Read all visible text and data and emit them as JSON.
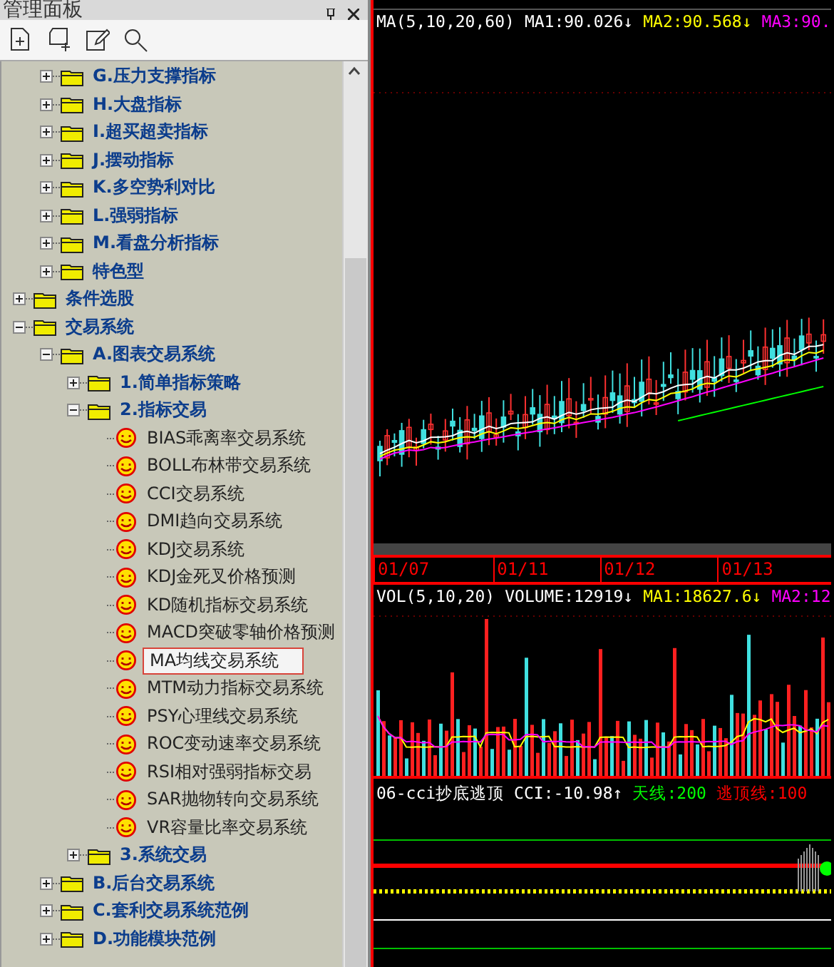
{
  "panel": {
    "title": "管理面板",
    "toolbar": [
      {
        "kind": "new-file"
      },
      {
        "kind": "new-folder"
      },
      {
        "kind": "edit"
      },
      {
        "kind": "search"
      }
    ],
    "partial_branch": [
      {
        "label": "G.压力支撑指标",
        "kind": "folder",
        "expanded": false,
        "selected": false
      },
      {
        "label": "H.大盘指标",
        "kind": "folder",
        "expanded": false,
        "selected": false
      },
      {
        "label": "I.超买超卖指标",
        "kind": "folder",
        "expanded": false,
        "selected": false
      },
      {
        "label": "J.摆动指标",
        "kind": "folder",
        "expanded": false,
        "selected": false
      },
      {
        "label": "K.多空势利对比",
        "kind": "folder",
        "expanded": false,
        "selected": false
      },
      {
        "label": "L.强弱指标",
        "kind": "folder",
        "expanded": false,
        "selected": false
      },
      {
        "label": "M.看盘分析指标",
        "kind": "folder",
        "expanded": false,
        "selected": false
      },
      {
        "label": "特色型",
        "kind": "folder",
        "expanded": false,
        "selected": false
      }
    ],
    "items": [
      {
        "label": "条件选股",
        "kind": "folder",
        "expanded": false,
        "selected": false
      },
      {
        "label": "交易系统",
        "kind": "folder",
        "expanded": true,
        "selected": false,
        "children": [
          {
            "label": "A.图表交易系统",
            "kind": "folder",
            "expanded": true,
            "selected": false,
            "children": [
              {
                "label": "1.简单指标策略",
                "kind": "folder",
                "expanded": false,
                "selected": false
              },
              {
                "label": "2.指标交易",
                "kind": "folder",
                "expanded": true,
                "selected": false,
                "children": [
                  {
                    "label": "BIAS乖离率交易系统",
                    "kind": "formula",
                    "selected": false
                  },
                  {
                    "label": "BOLL布林带交易系统",
                    "kind": "formula",
                    "selected": false
                  },
                  {
                    "label": "CCI交易系统",
                    "kind": "formula",
                    "selected": false
                  },
                  {
                    "label": "DMI趋向交易系统",
                    "kind": "formula",
                    "selected": false
                  },
                  {
                    "label": "KDJ交易系统",
                    "kind": "formula",
                    "selected": false
                  },
                  {
                    "label": "KDJ金死叉价格预测",
                    "kind": "formula",
                    "selected": false
                  },
                  {
                    "label": "KD随机指标交易系统",
                    "kind": "formula",
                    "selected": false
                  },
                  {
                    "label": "MACD突破零轴价格预测",
                    "kind": "formula",
                    "selected": false
                  },
                  {
                    "label": "MA均线交易系统",
                    "kind": "formula",
                    "selected": true
                  },
                  {
                    "label": "MTM动力指标交易系统",
                    "kind": "formula",
                    "selected": false
                  },
                  {
                    "label": "PSY心理线交易系统",
                    "kind": "formula",
                    "selected": false
                  },
                  {
                    "label": "ROC变动速率交易系统",
                    "kind": "formula",
                    "selected": false
                  },
                  {
                    "label": "RSI相对强弱指标交易",
                    "kind": "formula",
                    "selected": false
                  },
                  {
                    "label": "SAR抛物转向交易系统",
                    "kind": "formula",
                    "selected": false
                  },
                  {
                    "label": "VR容量比率交易系统",
                    "kind": "formula",
                    "selected": false
                  }
                ]
              },
              {
                "label": "3.系统交易",
                "kind": "folder",
                "expanded": false,
                "selected": false
              }
            ]
          },
          {
            "label": "B.后台交易系统",
            "kind": "folder",
            "expanded": false,
            "selected": false
          },
          {
            "label": "C.套利交易系统范例",
            "kind": "folder",
            "expanded": false,
            "selected": false
          },
          {
            "label": "D.功能模块范例",
            "kind": "folder",
            "expanded": false,
            "selected": false
          }
        ]
      }
    ]
  },
  "chart": {
    "main_legend": [
      {
        "text": "MA(5,10,20,60)",
        "color": "#ffffff"
      },
      {
        "text": "MA1:90.026↓",
        "color": "#ffffff"
      },
      {
        "text": "MA2:90.568↓",
        "color": "#ffff00"
      },
      {
        "text": "MA3:90.",
        "color": "#ff00ff"
      }
    ],
    "dates": [
      "01/07",
      "01/11",
      "01/12",
      "01/13"
    ],
    "volume_legend": [
      {
        "text": "VOL(5,10,20)",
        "color": "#ffffff"
      },
      {
        "text": "VOLUME:12919↓",
        "color": "#ffffff"
      },
      {
        "text": "MA1:18627.6↓",
        "color": "#ffff00"
      },
      {
        "text": "MA2:12",
        "color": "#ff00ff"
      }
    ],
    "cci_legend": [
      {
        "text": "06-cci抄底逃顶",
        "color": "#ffffff"
      },
      {
        "text": "CCI:-10.98↑",
        "color": "#ffffff"
      },
      {
        "text": "天线:200",
        "color": "#00ff00"
      },
      {
        "text": "逃顶线:100",
        "color": "#ff0000"
      }
    ]
  }
}
